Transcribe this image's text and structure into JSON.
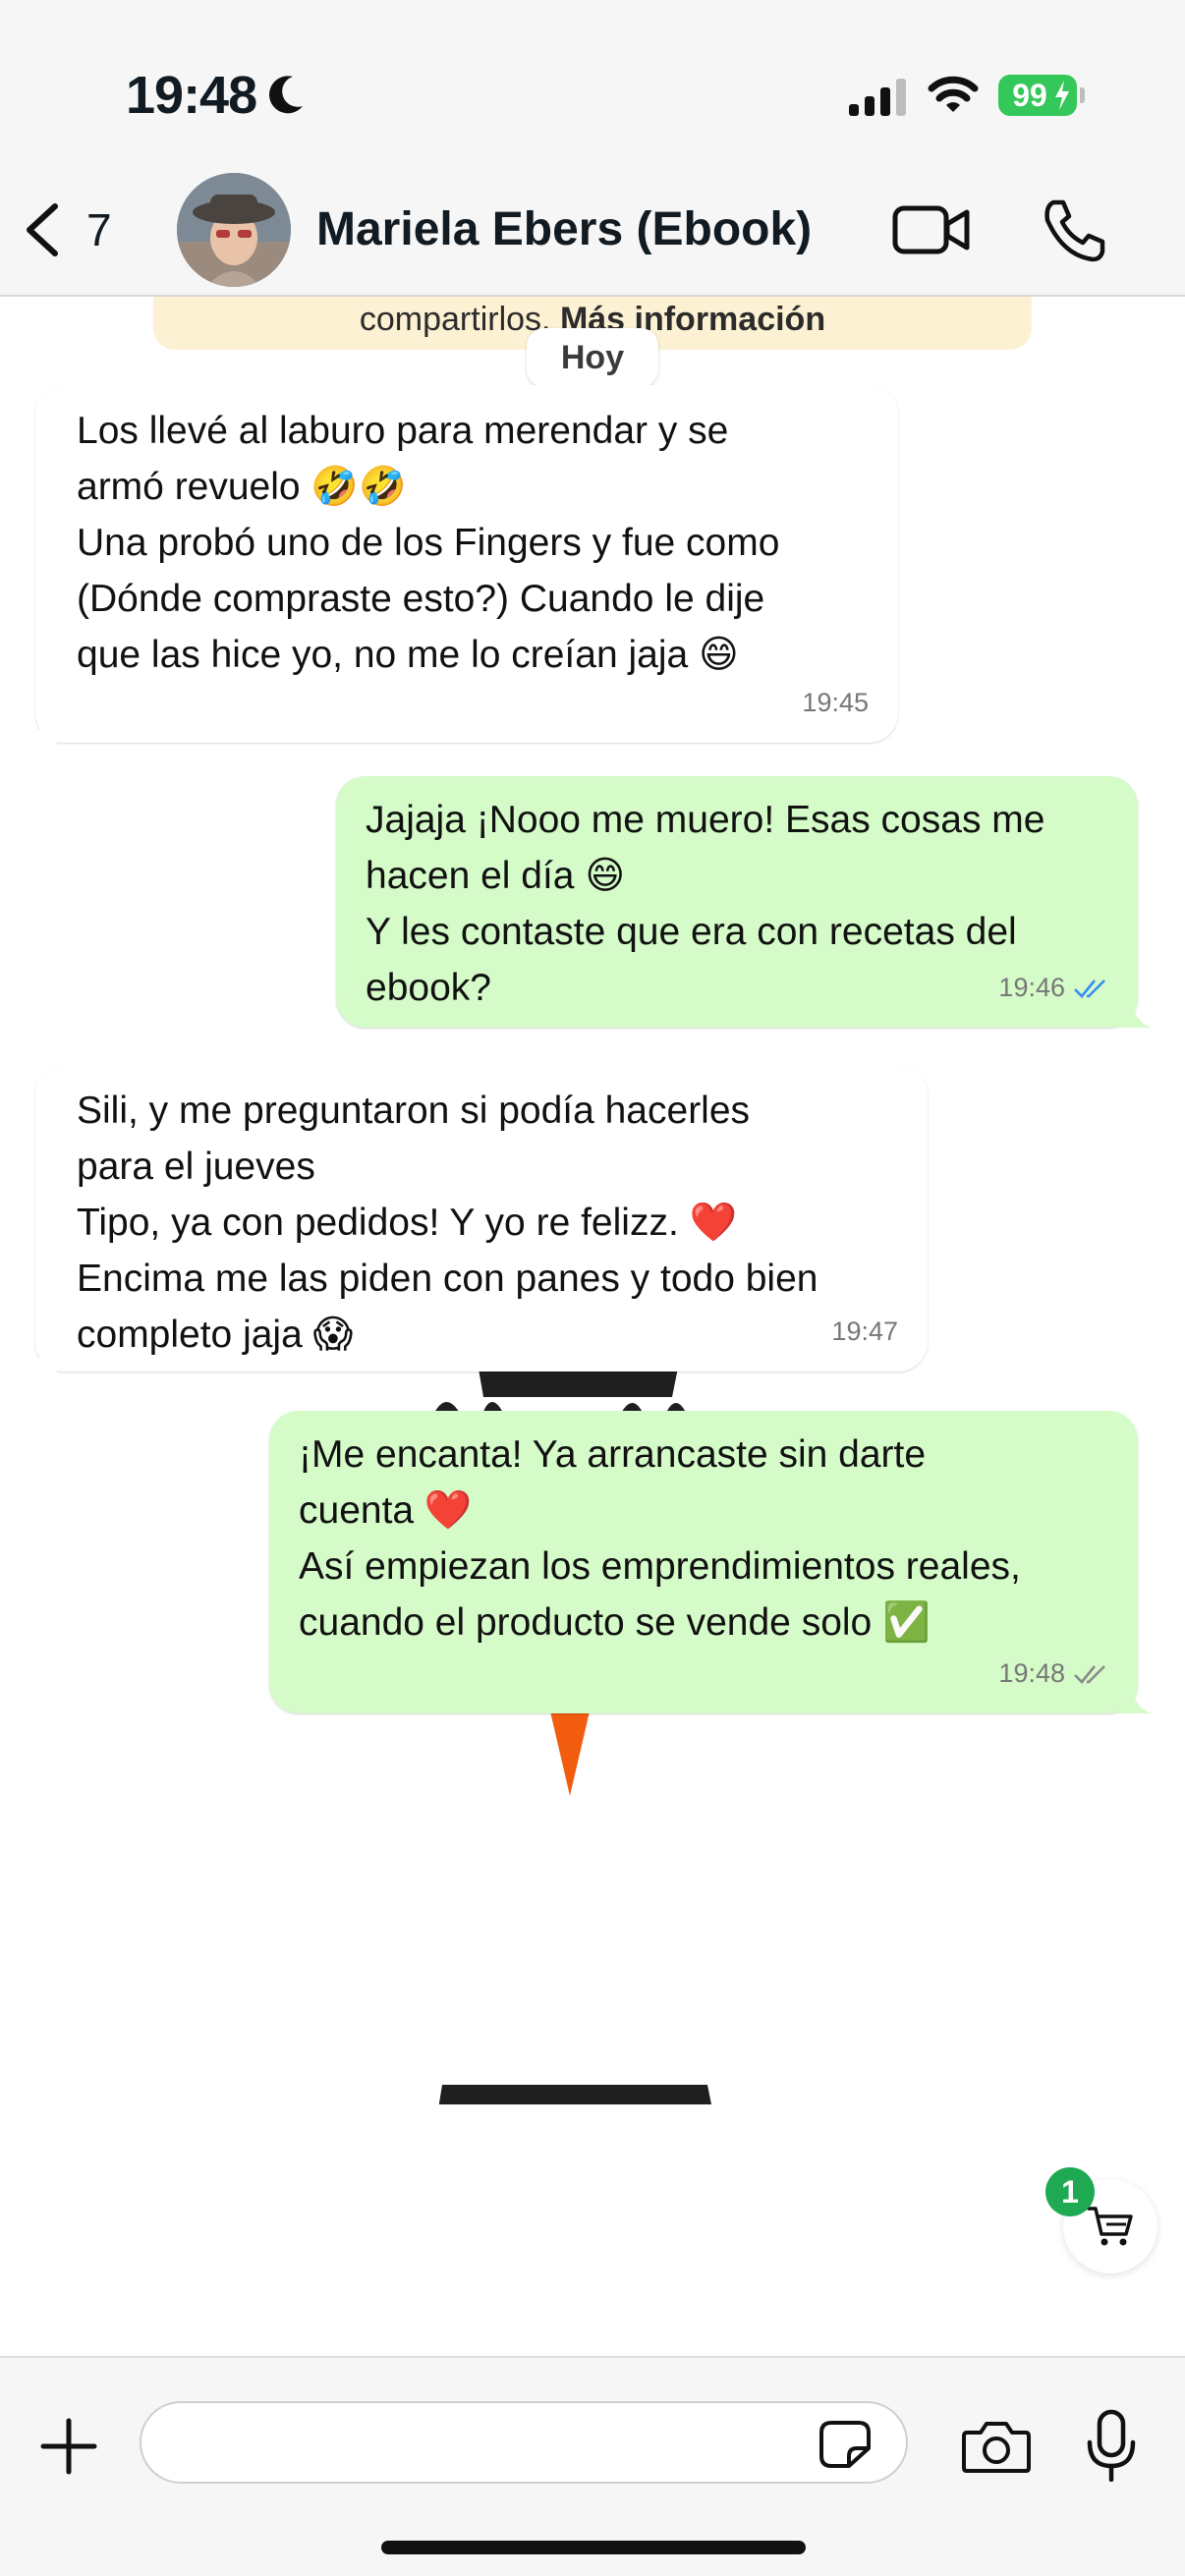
{
  "status_bar": {
    "time": "19:48",
    "battery": "99",
    "focus_icon": "moon-icon",
    "colors": {
      "battery": "#34c759"
    }
  },
  "header": {
    "back_count": "7",
    "contact_name": "Mariela Ebers (Ebook)"
  },
  "chat": {
    "info_banner_text": "compartirlos. ",
    "info_banner_link": "Más información",
    "day_label": "Hoy",
    "messages": [
      {
        "direction": "incoming",
        "text": "Los llevé al laburo para merendar y se\narmó revuelo 🤣🤣\nUna probó uno de los Fingers y fue como\n(Dónde compraste esto?) Cuando le dije\nque las hice yo, no me lo creían jaja 😄",
        "time": "19:45"
      },
      {
        "direction": "outgoing",
        "text": "Jajaja ¡Nooo me muero! Esas cosas me\nhacen el día 😄\nY les contaste que era con recetas del\nebook?",
        "time": "19:46",
        "status": "read"
      },
      {
        "direction": "incoming",
        "text": "Sili, y me preguntaron si podía hacerles\npara el jueves\nTipo, ya con pedidos! Y yo re felizz. ❤️\nEncima me las piden con panes y todo bien\ncompleto jaja 😱",
        "time": "19:47"
      },
      {
        "direction": "outgoing",
        "text": "¡Me encanta! Ya arrancaste sin darte\ncuenta  ❤️\nAsí empiezan los emprendimientos reales,\ncuando el producto se vende solo ✅",
        "time": "19:48",
        "status": "delivered"
      }
    ],
    "colors": {
      "outgoing_bubble": "#d4fbc8",
      "incoming_bubble": "#ffffff",
      "read_tick": "#3b8cf5",
      "info_banner": "#fdf1d3"
    }
  },
  "cart": {
    "badge_count": "1"
  },
  "composer": {
    "placeholder": ""
  }
}
